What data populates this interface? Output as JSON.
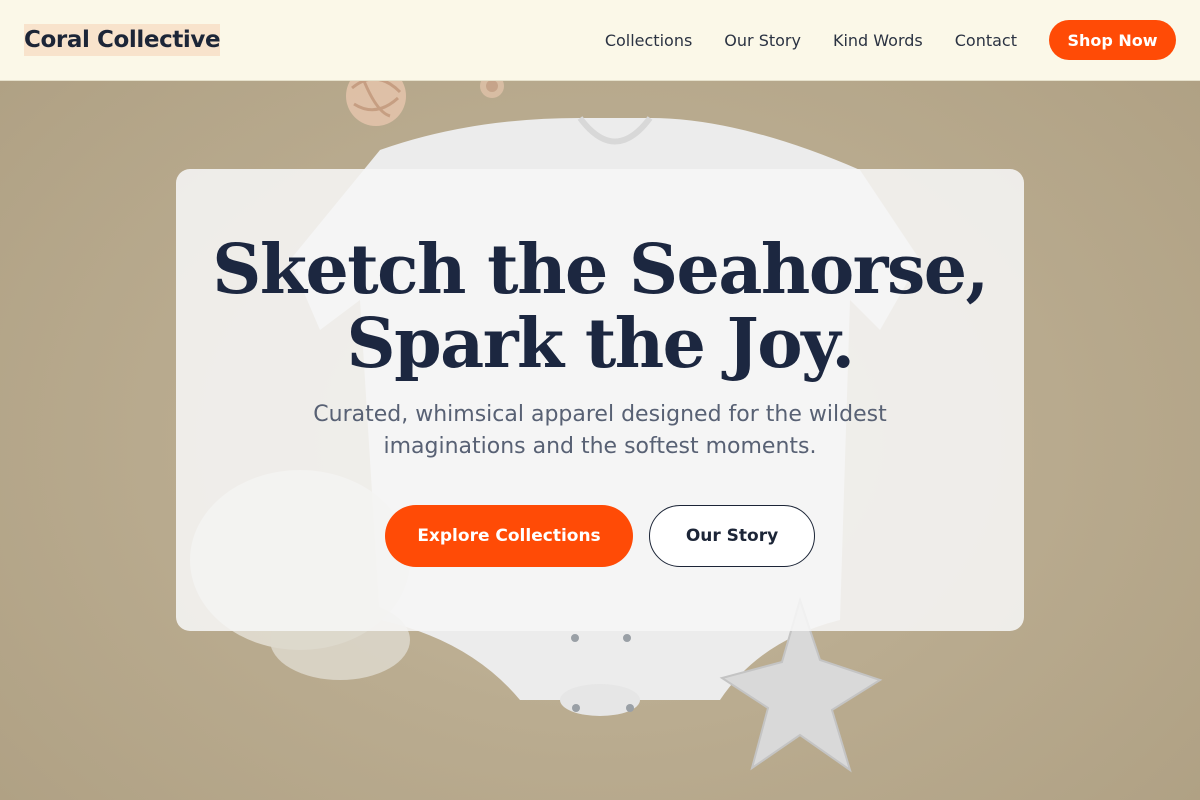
{
  "header": {
    "brand": "Coral Collective",
    "nav": [
      "Collections",
      "Our Story",
      "Kind Words",
      "Contact"
    ],
    "shop_button": "Shop Now"
  },
  "hero": {
    "headline_line1": "Sketch the Seahorse,",
    "headline_line2": "Spark the Joy.",
    "subhead": "Curated, whimsical apparel designed for the wildest imaginations and the softest moments.",
    "primary_cta": "Explore Collections",
    "secondary_cta": "Our Story",
    "background_image": "white baby onesie with star plush toy and wooden rattles on beige backdrop"
  },
  "colors": {
    "accent": "#ff4b06",
    "header_bg": "#fbf8e8",
    "brand_highlight": "#f8e3cc",
    "text_dark": "#1c2537",
    "backdrop": "#b9ab8f"
  }
}
